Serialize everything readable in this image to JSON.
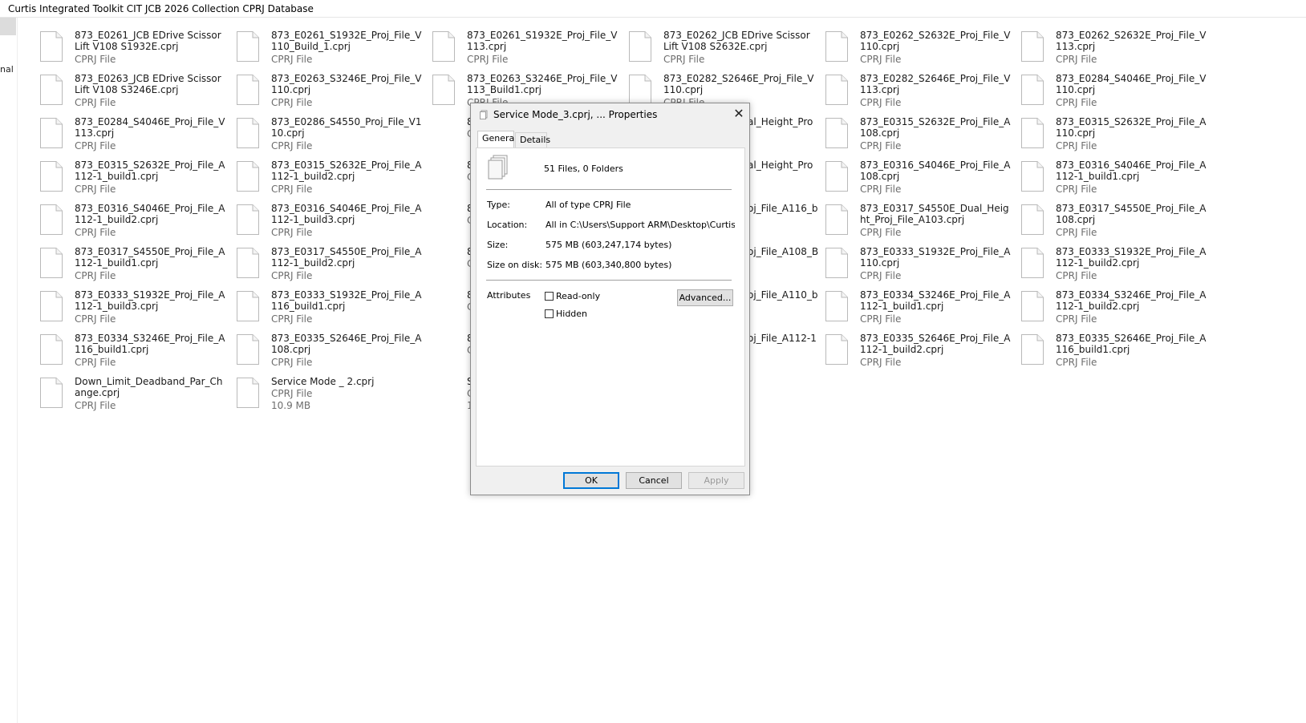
{
  "window": {
    "title": "Curtis Integrated Toolkit CIT JCB 2026 Collection CPRJ Database"
  },
  "nav": {
    "partial_text": "nal"
  },
  "files": [
    {
      "name": "873_E0261_JCB EDrive Scissor Lift V108 S1932E.cprj",
      "type": "CPRJ File"
    },
    {
      "name": "873_E0261_S1932E_Proj_File_V110_Build_1.cprj",
      "type": "CPRJ File"
    },
    {
      "name": "873_E0261_S1932E_Proj_File_V113.cprj",
      "type": "CPRJ File"
    },
    {
      "name": "873_E0262_JCB EDrive Scissor Lift V108 S2632E.cprj",
      "type": "CPRJ File"
    },
    {
      "name": "873_E0262_S2632E_Proj_File_V110.cprj",
      "type": "CPRJ File"
    },
    {
      "name": "873_E0262_S2632E_Proj_File_V113.cprj",
      "type": "CPRJ File"
    },
    {
      "name": "873_E0263_JCB EDrive Scissor Lift V108 S3246E.cprj",
      "type": "CPRJ File"
    },
    {
      "name": "873_E0263_S3246E_Proj_File_V110.cprj",
      "type": "CPRJ File"
    },
    {
      "name": "873_E0263_S3246E_Proj_File_V113_Build1.cprj",
      "type": "CPRJ File"
    },
    {
      "name": "873_E0282_S2646E_Proj_File_V110.cprj",
      "type": "CPRJ File"
    },
    {
      "name": "873_E0282_S2646E_Proj_File_V113.cprj",
      "type": "CPRJ File"
    },
    {
      "name": "873_E0284_S4046E_Proj_File_V110.cprj",
      "type": "CPRJ File"
    },
    {
      "name": "873_E0284_S4046E_Proj_File_V113.cprj",
      "type": "CPRJ File"
    },
    {
      "name": "873_E0286_S4550_Proj_File_V110.cprj",
      "type": "CPRJ File"
    },
    {
      "name": "8",
      "type": "C"
    },
    {
      "name": "al_Height_Pro",
      "type": ""
    },
    {
      "name": "873_E0315_S2632E_Proj_File_A108.cprj",
      "type": "CPRJ File"
    },
    {
      "name": "873_E0315_S2632E_Proj_File_A110.cprj",
      "type": "CPRJ File"
    },
    {
      "name": "873_E0315_S2632E_Proj_File_A112-1_build1.cprj",
      "type": "CPRJ File"
    },
    {
      "name": "873_E0315_S2632E_Proj_File_A112-1_build2.cprj",
      "type": "CPRJ File"
    },
    {
      "name": "8",
      "type": "C"
    },
    {
      "name": "al_Height_Pro",
      "type": ""
    },
    {
      "name": "873_E0316_S4046E_Proj_File_A108.cprj",
      "type": "CPRJ File"
    },
    {
      "name": "873_E0316_S4046E_Proj_File_A112-1_build1.cprj",
      "type": "CPRJ File"
    },
    {
      "name": "873_E0316_S4046E_Proj_File_A112-1_build2.cprj",
      "type": "CPRJ File"
    },
    {
      "name": "873_E0316_S4046E_Proj_File_A112-1_build3.cprj",
      "type": "CPRJ File"
    },
    {
      "name": "8",
      "type": "C"
    },
    {
      "name": "oj_File_A116_b",
      "type": ""
    },
    {
      "name": "873_E0317_S4550E_Dual_Height_Proj_File_A103.cprj",
      "type": "CPRJ File"
    },
    {
      "name": "873_E0317_S4550E_Proj_File_A108.cprj",
      "type": "CPRJ File"
    },
    {
      "name": "873_E0317_S4550E_Proj_File_A112-1_build1.cprj",
      "type": "CPRJ File"
    },
    {
      "name": "873_E0317_S4550E_Proj_File_A112-1_build2.cprj",
      "type": "CPRJ File"
    },
    {
      "name": "8",
      "type": "C"
    },
    {
      "name": "oj_File_A108_B",
      "type": ""
    },
    {
      "name": "873_E0333_S1932E_Proj_File_A110.cprj",
      "type": "CPRJ File"
    },
    {
      "name": "873_E0333_S1932E_Proj_File_A112-1_build2.cprj",
      "type": "CPRJ File"
    },
    {
      "name": "873_E0333_S1932E_Proj_File_A112-1_build3.cprj",
      "type": "CPRJ File"
    },
    {
      "name": "873_E0333_S1932E_Proj_File_A116_build1.cprj",
      "type": "CPRJ File"
    },
    {
      "name": "8",
      "type": "C"
    },
    {
      "name": "oj_File_A110_b",
      "type": ""
    },
    {
      "name": "873_E0334_S3246E_Proj_File_A112-1_build1.cprj",
      "type": "CPRJ File"
    },
    {
      "name": "873_E0334_S3246E_Proj_File_A112-1_build2.cprj",
      "type": "CPRJ File"
    },
    {
      "name": "873_E0334_S3246E_Proj_File_A116_build1.cprj",
      "type": "CPRJ File"
    },
    {
      "name": "873_E0335_S2646E_Proj_File_A108.cprj",
      "type": "CPRJ File"
    },
    {
      "name": "8",
      "type": "C"
    },
    {
      "name": "oj_File_A112-1",
      "type": ""
    },
    {
      "name": "873_E0335_S2646E_Proj_File_A112-1_build2.cprj",
      "type": "CPRJ File"
    },
    {
      "name": "873_E0335_S2646E_Proj_File_A116_build1.cprj",
      "type": "CPRJ File"
    },
    {
      "name": "Down_Limit_Deadband_Par_Change.cprj",
      "type": "CPRJ File"
    },
    {
      "name": "Service Mode _ 2.cprj",
      "type": "CPRJ File",
      "size": "10.9 MB"
    },
    {
      "name": "S",
      "type": "C",
      "size": "1"
    }
  ],
  "dialog": {
    "title": "Service Mode_3.cprj, ... Properties",
    "tabs": [
      "General",
      "Details"
    ],
    "summary": "51 Files, 0 Folders",
    "type_label": "Type:",
    "type_value": "All of type CPRJ File",
    "location_label": "Location:",
    "location_value": "All in C:\\Users\\Support ARM\\Desktop\\Curtis Integrated Toolkit",
    "size_label": "Size:",
    "size_value": "575 MB (603,247,174 bytes)",
    "size_on_disk_label": "Size on disk:",
    "size_on_disk_value": "575 MB (603,340,800 bytes)",
    "attributes_label": "Attributes",
    "readonly_label": "Read-only",
    "hidden_label": "Hidden",
    "advanced_label": "Advanced...",
    "ok_label": "OK",
    "cancel_label": "Cancel",
    "apply_label": "Apply"
  }
}
